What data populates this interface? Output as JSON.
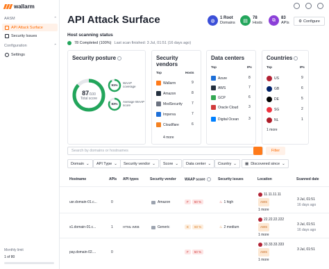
{
  "app": {
    "logo_text": "wallarm"
  },
  "sidebar": {
    "group_aasm": "AASM",
    "items_aasm": [
      {
        "label": "API Attack Surface",
        "active": true,
        "icon": "target-icon"
      },
      {
        "label": "Security Issues",
        "active": false,
        "icon": "shield-icon"
      }
    ],
    "group_config": "Configuration",
    "items_config": [
      {
        "label": "Settings",
        "active": false,
        "icon": "gear-icon"
      }
    ],
    "monthly_limit_label": "Monthly limit",
    "monthly_limit_value": "1 of 80"
  },
  "header": {
    "title": "API Attack Surface",
    "stats": [
      {
        "value": "1 Root",
        "label": "Domains",
        "color": "#3b4fd8"
      },
      {
        "value": "78",
        "label": "Hosts",
        "color": "#22a55b"
      },
      {
        "value": "83",
        "label": "APIs",
        "color": "#8b3fd8"
      }
    ],
    "configure_label": "Configure"
  },
  "scan": {
    "title": "Host scanning status",
    "completed": "78 Completed (100%)",
    "last_scan": "Last scan finished: 3 Jul, 01:51 (16 days ago)"
  },
  "posture": {
    "title": "Security posture",
    "score": "87",
    "score_max": "/100",
    "score_label": "Total score",
    "waap_coverage_pct": "91%",
    "waap_coverage_label": "WAAP coverage",
    "avg_waap_pct": "83%",
    "avg_waap_label": "Average WAAP score",
    "score_value": 87,
    "waap_coverage_value": 91,
    "avg_waap_value": 83
  },
  "vendors": {
    "title": "Security vendors",
    "col_top": "Top",
    "col_hosts": "Hosts",
    "rows": [
      {
        "name": "Wallarm",
        "hosts": "9",
        "color": "#ff7a1a"
      },
      {
        "name": "Amazon",
        "hosts": "8",
        "color": "#232f3e"
      },
      {
        "name": "ModSecurity",
        "hosts": "7",
        "color": "#6b7280"
      },
      {
        "name": "Imperva",
        "hosts": "7",
        "color": "#1d6fd8"
      },
      {
        "name": "Cloudflare",
        "hosts": "6",
        "color": "#f48120"
      }
    ],
    "more": "4 more"
  },
  "datacenters": {
    "title": "Data centers",
    "col_top": "Top",
    "col_ips": "IPs",
    "rows": [
      {
        "name": "Azure",
        "ips": "8",
        "color": "#1d6fd8"
      },
      {
        "name": "AWS",
        "ips": "7",
        "color": "#232f3e"
      },
      {
        "name": "GCP",
        "ips": "6",
        "color": "#34a853"
      },
      {
        "name": "Oracle Cloud",
        "ips": "3",
        "color": "#d13b3b"
      },
      {
        "name": "Digital Ocean",
        "ips": "3",
        "color": "#0080ff"
      }
    ]
  },
  "countries": {
    "title": "Countries",
    "col_top": "Top",
    "col_ips": "IPs",
    "rows": [
      {
        "name": "US",
        "ips": "9",
        "color": "#b22234"
      },
      {
        "name": "GB",
        "ips": "6",
        "color": "#012169"
      },
      {
        "name": "DE",
        "ips": "5",
        "color": "#000000"
      },
      {
        "name": "SG",
        "ips": "2",
        "color": "#ef3340"
      },
      {
        "name": "NL",
        "ips": "1",
        "color": "#ae1c28"
      }
    ],
    "more": "1 more"
  },
  "search": {
    "placeholder": "Search by domains or hostnames",
    "filter_label": "Filter"
  },
  "chips": [
    "Domain",
    "API Type",
    "Security vendor",
    "Score",
    "Data center",
    "Country",
    "Discovered since"
  ],
  "table": {
    "headers": [
      "Hostname",
      "APIs",
      "API types",
      "Security vendor",
      "WAAP score",
      "Security issues",
      "Location",
      "Scanned date"
    ],
    "rows": [
      {
        "hostname": "usr.domain-01.c...",
        "apis": "0",
        "api_types": "",
        "vendor": "Amazon",
        "grade": "F",
        "grade_pct": "50 %",
        "issues": "1 high",
        "ip": "11.11.11.11",
        "loc_tag": "AWS",
        "loc_more": "1 more",
        "date": "3 Jul, 01:51",
        "date_ago": "16 days ago"
      },
      {
        "hostname": "s1.domain-01.c...",
        "apis": "1",
        "api_types": "HTML WEB",
        "vendor": "Generic",
        "grade": "E",
        "grade_pct": "60 %",
        "issues": "2 medium",
        "ip": "22.22.22.222",
        "loc_tag": "AWS",
        "loc_more": "1 more",
        "date": "3 Jul, 01:51",
        "date_ago": "16 days ago"
      },
      {
        "hostname": "pay.domain-02....",
        "apis": "0",
        "api_types": "",
        "vendor": "",
        "grade": "F",
        "grade_pct": "50 %",
        "issues": "",
        "ip": "33.33.33.333",
        "loc_tag": "AWS",
        "loc_more": "1 more",
        "date": "3 Jul, 01:51",
        "date_ago": ""
      }
    ]
  }
}
